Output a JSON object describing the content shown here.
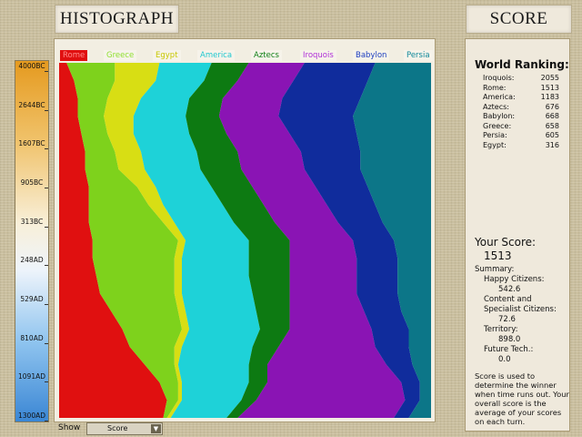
{
  "header": {
    "histograph_title": "HISTOGRAPH",
    "score_title": "SCORE"
  },
  "timeline": {
    "ticks": [
      "4000BC",
      "2644BC",
      "1607BC",
      "905BC",
      "313BC",
      "248AD",
      "529AD",
      "810AD",
      "1091AD",
      "1300AD"
    ]
  },
  "legend": [
    {
      "name": "Rome",
      "color": "#e01010",
      "text_color": "#ff5050"
    },
    {
      "name": "Greece",
      "color": "#7ed21c",
      "text_color": "#90e030"
    },
    {
      "name": "Egypt",
      "color": "#d8de14",
      "text_color": "#c8c800"
    },
    {
      "name": "America",
      "color": "#1ed2d8",
      "text_color": "#20c8d0"
    },
    {
      "name": "Aztecs",
      "color": "#0d7a12",
      "text_color": "#108018"
    },
    {
      "name": "Iroquois",
      "color": "#8a14b4",
      "text_color": "#b030d8"
    },
    {
      "name": "Babylon",
      "color": "#102c9c",
      "text_color": "#2040c0"
    },
    {
      "name": "Persia",
      "color": "#0c7688",
      "text_color": "#10889a"
    }
  ],
  "chart_data": {
    "type": "area",
    "stacked": true,
    "normalized": true,
    "x_ticks": [
      "4000BC",
      "2644BC",
      "1607BC",
      "905BC",
      "313BC",
      "248AD",
      "529AD",
      "810AD",
      "1091AD",
      "1300AD"
    ],
    "x": [
      0,
      0.05,
      0.1,
      0.15,
      0.2,
      0.25,
      0.3,
      0.35,
      0.4,
      0.45,
      0.5,
      0.55,
      0.6,
      0.65,
      0.7,
      0.75,
      0.8,
      0.85,
      0.9,
      0.95,
      1.0
    ],
    "series": [
      {
        "name": "Rome",
        "values": [
          2,
          4,
          5,
          5,
          6,
          7,
          7,
          8,
          8,
          8,
          9,
          9,
          10,
          11,
          14,
          17,
          19,
          23,
          27,
          29,
          28
        ]
      },
      {
        "name": "Greece",
        "values": [
          13,
          11,
          8,
          7,
          7,
          8,
          9,
          13,
          16,
          20,
          23,
          22,
          21,
          20,
          18,
          16,
          12,
          8,
          5,
          3,
          1
        ]
      },
      {
        "name": "Egypt",
        "values": [
          12,
          11,
          9,
          8,
          7,
          7,
          7,
          5,
          4,
          3,
          2,
          2,
          2,
          2,
          2,
          2,
          2,
          1,
          1,
          1,
          1
        ]
      },
      {
        "name": "America",
        "values": [
          14,
          13,
          13,
          14,
          15,
          15,
          15,
          15,
          16,
          16,
          17,
          18,
          18,
          19,
          19,
          19,
          19,
          19,
          18,
          16,
          15
        ]
      },
      {
        "name": "Aztecs",
        "values": [
          10,
          9,
          9,
          9,
          10,
          11,
          11,
          11,
          11,
          11,
          11,
          11,
          11,
          10,
          9,
          8,
          7,
          5,
          5,
          4,
          3
        ]
      },
      {
        "name": "Iroquois",
        "values": [
          15,
          15,
          16,
          16,
          17,
          17,
          17,
          17,
          17,
          17,
          17,
          18,
          18,
          18,
          20,
          22,
          26,
          32,
          36,
          40,
          42
        ]
      },
      {
        "name": "Babylon",
        "values": [
          19,
          20,
          21,
          20,
          18,
          16,
          15,
          14,
          13,
          12,
          11,
          11,
          11,
          11,
          10,
          10,
          9,
          7,
          5,
          4,
          4
        ]
      },
      {
        "name": "Persia",
        "values": [
          15,
          17,
          19,
          21,
          20,
          19,
          19,
          17,
          15,
          13,
          10,
          9,
          9,
          9,
          8,
          6,
          6,
          5,
          3,
          3,
          6
        ]
      }
    ]
  },
  "score_panel": {
    "ranking_title": "World Ranking:",
    "rankings": [
      {
        "name": "Iroquois:",
        "score": "2055"
      },
      {
        "name": "Rome:",
        "score": "1513"
      },
      {
        "name": "America:",
        "score": "1183"
      },
      {
        "name": "Aztecs:",
        "score": "676"
      },
      {
        "name": "Babylon:",
        "score": "668"
      },
      {
        "name": "Greece:",
        "score": "658"
      },
      {
        "name": "Persia:",
        "score": "605"
      },
      {
        "name": "Egypt:",
        "score": "316"
      }
    ],
    "your_score_label": "Your Score:",
    "your_score_value": "1513",
    "summary_label": "Summary:",
    "happy_label": "Happy Citizens:",
    "happy_value": "542.6",
    "content_label_1": "Content and",
    "content_label_2": "Specialist Citizens:",
    "content_value": "72.6",
    "territory_label": "Territory:",
    "territory_value": "898.0",
    "future_label": "Future Tech.:",
    "future_value": "0.0",
    "explanation": "Score is used to determine the winner when time runs out. Your overall score is the average of your scores on each turn."
  },
  "show_control": {
    "label": "Show",
    "selected": "Score"
  }
}
